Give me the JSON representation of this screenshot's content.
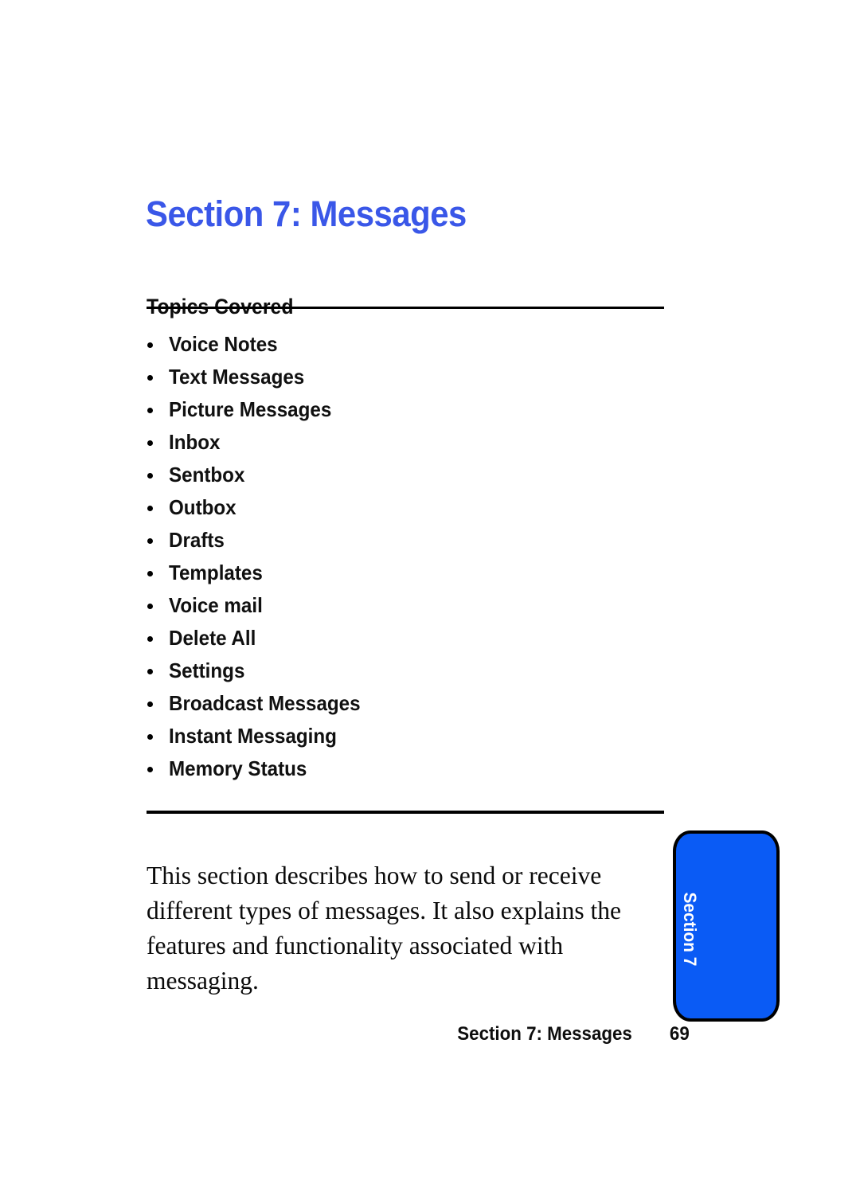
{
  "document": {
    "section_title": "Section 7: Messages",
    "topics_heading": "Topics Covered",
    "topics": [
      "Voice Notes",
      "Text Messages",
      "Picture Messages",
      "Inbox",
      "Sentbox",
      "Outbox",
      "Drafts",
      "Templates",
      "Voice mail",
      "Delete All",
      "Settings",
      "Broadcast Messages",
      "Instant Messaging",
      "Memory Status"
    ],
    "body_paragraph": "This section describes how to send or receive different types of messages. It also explains the features and functionality associated with messaging.",
    "side_tab": {
      "label": "Section 7"
    },
    "footer": {
      "section_label": "Section 7: Messages",
      "page_number": "69"
    },
    "colors": {
      "title_blue": "#3a57e8",
      "tab_blue": "#0a5bf5",
      "tab_outline": "#000000",
      "tab_text": "#ffffff",
      "text_black": "#0d0d0d",
      "page_background": "#ffffff"
    }
  }
}
